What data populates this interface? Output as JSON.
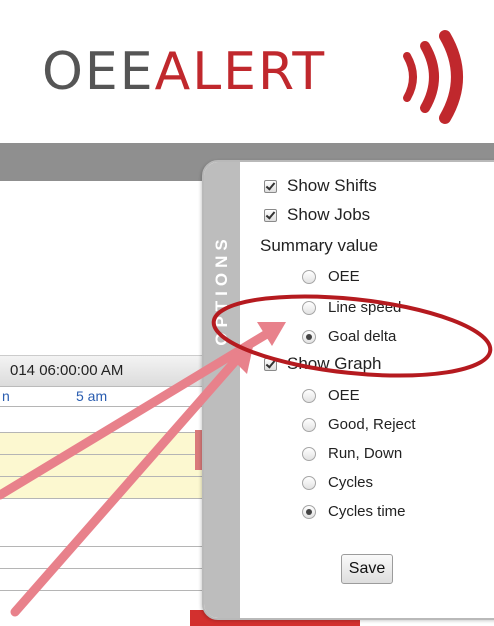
{
  "header": {
    "logo_oee": "OEE",
    "logo_alert": "ALERT"
  },
  "calendar": {
    "date_text": "014 06:00:00 AM",
    "hours": [
      {
        "label": "n"
      },
      {
        "label": "5 am"
      }
    ]
  },
  "options": {
    "tab_label": "OPTIONS",
    "show_shifts": "Show Shifts",
    "show_jobs": "Show Jobs",
    "summary_label": "Summary value",
    "summary_options": [
      "OEE",
      "Line speed",
      "Goal delta"
    ],
    "summary_selected": "Goal delta",
    "show_graph": "Show Graph",
    "graph_options": [
      "OEE",
      "Good, Reject",
      "Run, Down",
      "Cycles",
      "Cycles time"
    ],
    "graph_selected": "Cycles time",
    "save_label": "Save"
  },
  "colors": {
    "brand_red": "#c0282d",
    "logo_gray": "#555555",
    "annotation_red": "#b51a1f",
    "arrow_pink": "#e8818b"
  }
}
